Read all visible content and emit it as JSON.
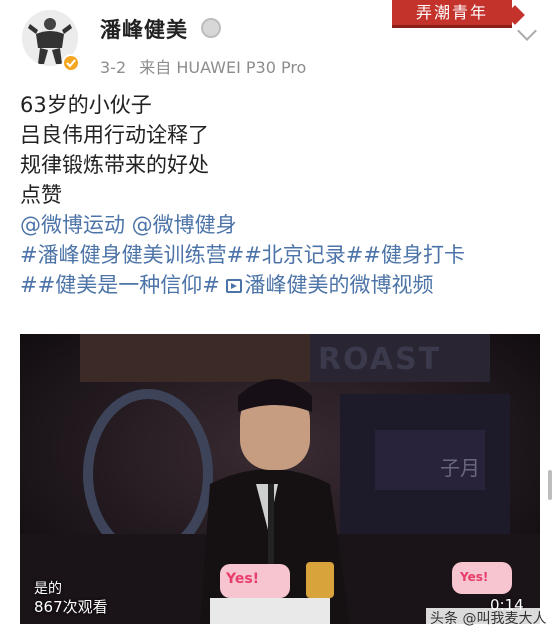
{
  "header": {
    "user_name": "潘峰健美",
    "post_date": "3-2",
    "source_label": "来自 HUAWEI P30 Pro",
    "brand_tag": "弄潮青年",
    "avatar_icon": "bodybuilder-avatar-icon",
    "verified_icon": "verified-badge-icon",
    "medal_icon": "medal-icon"
  },
  "post": {
    "lines": [
      "63岁的小伙子",
      "吕良伟用行动诠释了",
      "规律锻炼带来的好处",
      "点赞"
    ],
    "mentions": "@微博运动 @微博健身",
    "tags_line1": "#潘峰健身健美训练营##北京记录##健身打卡",
    "tags_line2_prefix": "##健美是一种信仰# ",
    "video_link": "潘峰健美的微博视频"
  },
  "video": {
    "sign_text": "ROAST",
    "sign_extra": "子月",
    "views_prefix": "是的",
    "views": "867次观看",
    "duration": "0:14",
    "sticker_text": "Yes!",
    "sticker_text_2": "Yes!"
  },
  "footer": {
    "watermark": "头条 @叫我麦大人"
  },
  "colors": {
    "link_blue": "#4d74a8",
    "brand_red": "#c4322c",
    "badge_orange": "#f5a623"
  }
}
